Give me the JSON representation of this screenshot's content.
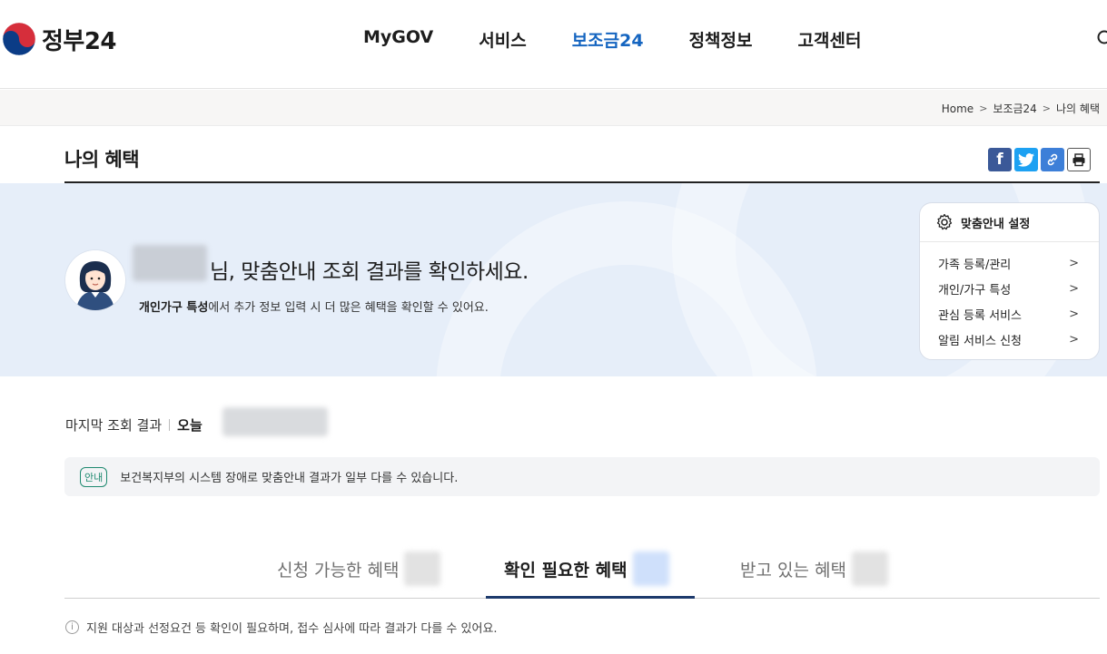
{
  "header": {
    "logo_text": "정부24",
    "nav": [
      "MyGOV",
      "서비스",
      "보조금24",
      "정책정보",
      "고객센터"
    ],
    "active_nav": "보조금24"
  },
  "breadcrumb": [
    "Home",
    "보조금24",
    "나의 혜택"
  ],
  "page": {
    "title": "나의 혜택"
  },
  "banner": {
    "greeting_suffix": "님, 맞춤안내 조회 결과를 확인하세요.",
    "sub_bold": "개인가구 특성",
    "sub_rest": "에서 추가 정보 입력 시 더 많은 혜택을 확인할 수 있어요."
  },
  "settings": {
    "title": "맞춤안내 설정",
    "items": [
      {
        "label": "가족 등록/관리"
      },
      {
        "label": "개인/가구 특성"
      },
      {
        "label": "관심 등록 서비스"
      },
      {
        "label": "알림 서비스 신청"
      }
    ]
  },
  "lookup": {
    "label": "마지막 조회 결과",
    "today": "오늘"
  },
  "notice": {
    "badge": "안내",
    "text": "보건복지부의 시스템 장애로 맞춤안내 결과가 일부 다를 수 있습니다."
  },
  "tabs": [
    {
      "label": "신청 가능한 혜택"
    },
    {
      "label": "확인 필요한 혜택"
    },
    {
      "label": "받고 있는 혜택"
    }
  ],
  "active_tab": "확인 필요한 혜택",
  "info": {
    "text": "지원 대상과 선정요건 등 확인이 필요하며, 접수 심사에 따라 결과가 다를 수 있어요."
  },
  "colors": {
    "accent": "#1565c0",
    "banner_bg": "#e6eef9",
    "tab_underline": "#1d3a6c",
    "notice_badge": "#1f8a70"
  },
  "icons": [
    "taegeuk-logo-icon",
    "search-icon",
    "facebook-icon",
    "twitter-icon",
    "link-icon",
    "print-icon",
    "gear-icon",
    "chevron-right-icon",
    "info-icon",
    "avatar-icon"
  ]
}
